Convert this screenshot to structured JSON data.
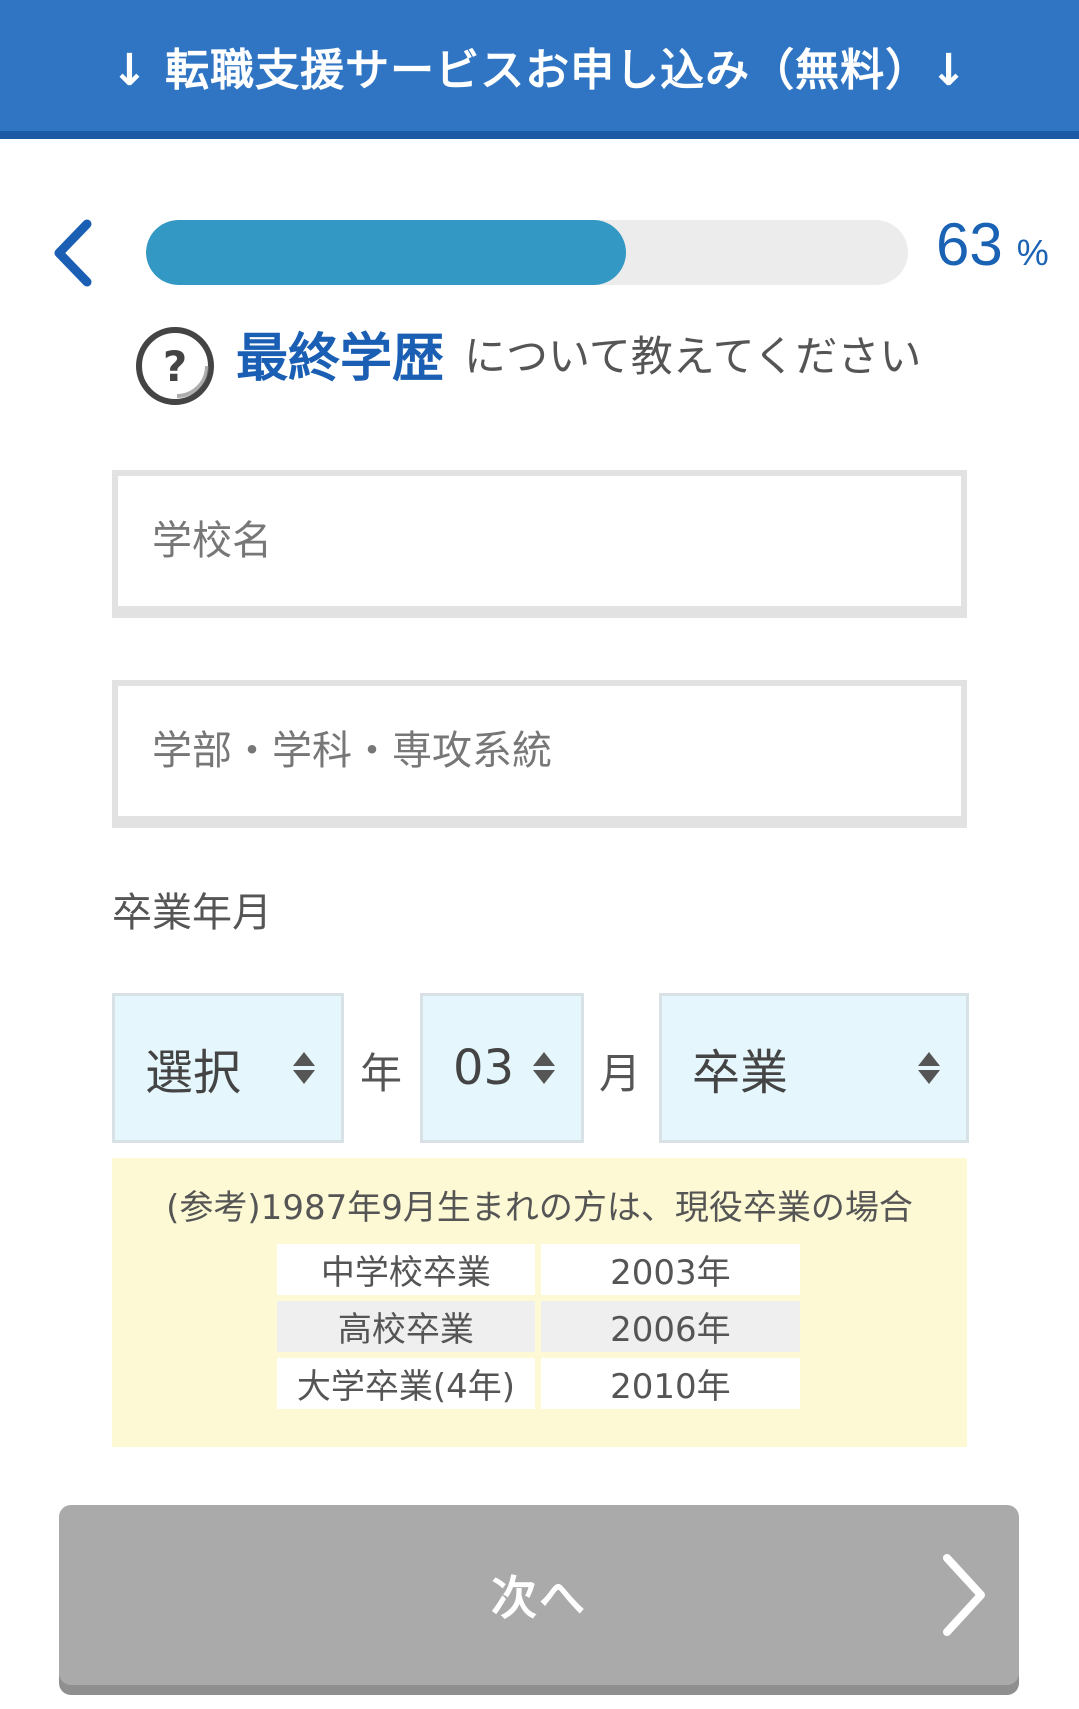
{
  "header": {
    "title": "↓ 転職支援サービスお申し込み（無料）↓"
  },
  "progress": {
    "percent": 63,
    "value": "63",
    "unit": "%"
  },
  "question": {
    "highlight": "最終学歴",
    "rest": "について教えてください"
  },
  "form": {
    "school_placeholder": "学校名",
    "faculty_placeholder": "学部・学科・専攻系統",
    "graduation_label": "卒業年月",
    "year_select": "選択",
    "year_unit": "年",
    "month_select": "03",
    "month_unit": "月",
    "status_select": "卒業"
  },
  "reference": {
    "title": "(参考)1987年9月生まれの方は、現役卒業の場合",
    "rows": [
      {
        "label": "中学校卒業",
        "year": "2003年"
      },
      {
        "label": "高校卒業",
        "year": "2006年"
      },
      {
        "label": "大学卒業(4年)",
        "year": "2010年"
      }
    ]
  },
  "next_button": {
    "label": "次へ"
  },
  "colors": {
    "header": "#2f75c3",
    "accent": "#1a5fb4",
    "progress_fill": "#3399c4",
    "select_bg": "#e5f6fd",
    "reference_bg": "#fdf9d4",
    "button_disabled": "#aaaaaa"
  },
  "icons": {
    "back": "chevron-left-icon",
    "help": "question-circle-icon",
    "sort": "sort-arrows-icon",
    "next": "chevron-right-icon"
  }
}
